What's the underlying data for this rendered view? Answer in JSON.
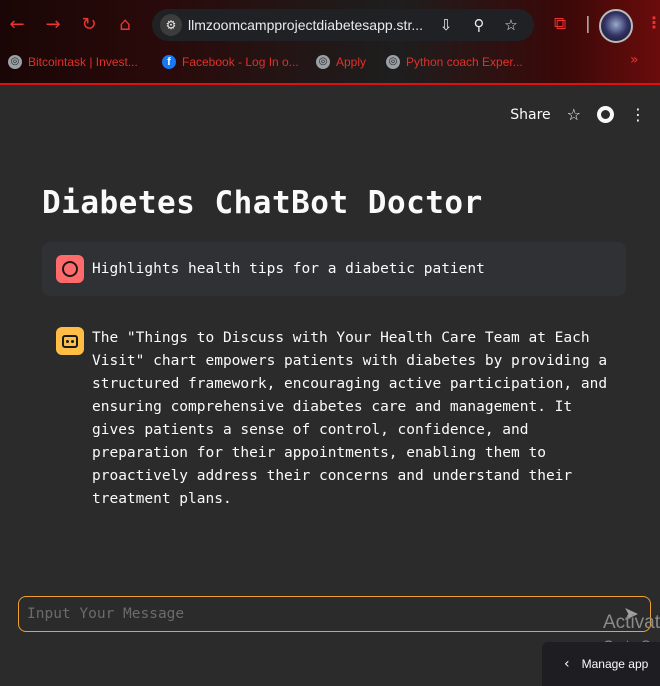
{
  "browser": {
    "url": "llmzoomcampprojectdiabetesapp.str...",
    "bookmarks": [
      {
        "label": "Bitcointask | Invest..."
      },
      {
        "label": "Facebook - Log In o..."
      },
      {
        "label": "Apply"
      },
      {
        "label": "Python coach Exper..."
      }
    ],
    "more_bookmarks": "»",
    "accent_color": "#e0312b"
  },
  "header": {
    "share_label": "Share"
  },
  "app": {
    "title": "Diabetes ChatBot Doctor",
    "messages": [
      {
        "role": "user",
        "text": "Highlights health tips for a diabetic patient"
      },
      {
        "role": "assistant",
        "text": "The \"Things to Discuss with Your Health Care Team at Each Visit\" chart empowers patients with diabetes by providing a structured framework, encouraging active participation, and ensuring comprehensive diabetes care and management. It gives patients a sense of control, confidence, and preparation for their appointments, enabling them to proactively address their concerns and understand their treatment plans."
      }
    ],
    "input": {
      "placeholder": "Input Your Message",
      "value": ""
    },
    "input_border_color": "#f0a030",
    "user_avatar_color": "#ff6b6b",
    "bot_avatar_color": "#ffbd45"
  },
  "overlay": {
    "activate_text": "Activat",
    "goto_text": "Go to Se"
  },
  "manage_app": {
    "label": "Manage app"
  }
}
